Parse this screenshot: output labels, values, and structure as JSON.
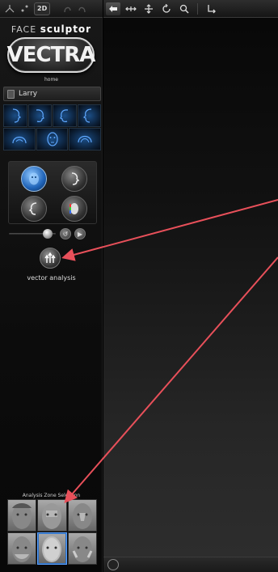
{
  "toolbar_left": {
    "mode_2d": "2D"
  },
  "brand": {
    "prefix": "FACE",
    "product": "sculptor",
    "logo_text": "VECTRA",
    "home_label": "home"
  },
  "patient": {
    "name": "Larry"
  },
  "view_rows": [
    {
      "row": "profile-views",
      "count": 4
    },
    {
      "row": "front-views",
      "count": 3
    }
  ],
  "tools": [
    {
      "name": "face-tool",
      "active": true
    },
    {
      "name": "profile-tool",
      "active": false
    },
    {
      "name": "contour-tool",
      "active": false
    },
    {
      "name": "color-map-tool",
      "active": false
    }
  ],
  "slider": {
    "level": 0.8
  },
  "vector_analysis": {
    "label": "vector analysis"
  },
  "zone_selection": {
    "title": "Analysis Zone Selection",
    "zones": [
      "upper-left",
      "upper-center",
      "upper-right",
      "lower-left",
      "lower-center",
      "lower-right"
    ],
    "selected": "lower-center"
  },
  "colors": {
    "annotation_arrow": "#e8505a",
    "active_blue": "#1f63b8",
    "background": "#000000"
  }
}
